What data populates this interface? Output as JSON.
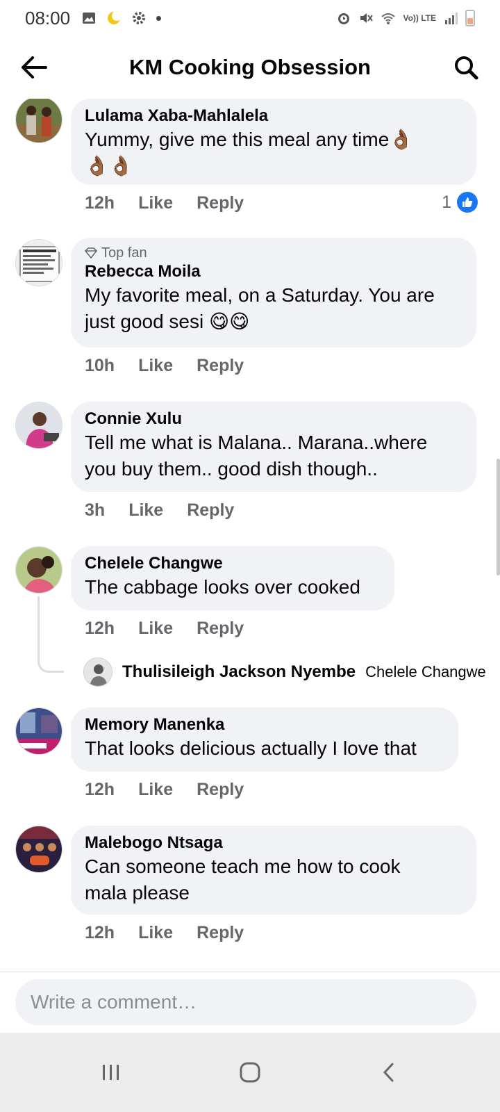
{
  "status_bar": {
    "time": "08:00",
    "network": "Vo)) LTE"
  },
  "header": {
    "title": "KM Cooking Obsession"
  },
  "comments": [
    {
      "author": "Lulama Xaba-Mahlalela",
      "text_line1": "Yummy,  give me this meal any time👌🏾",
      "text_line2": "👌🏾👌🏾",
      "time": "12h",
      "like": "Like",
      "reply": "Reply",
      "like_count": "1"
    },
    {
      "badge": "Top fan",
      "author": "Rebecca Moila",
      "text_line1": "My favorite meal, on a Saturday. You are",
      "text_line2": "just good sesi 😋😋",
      "time": "10h",
      "like": "Like",
      "reply": "Reply"
    },
    {
      "author": "Connie Xulu",
      "text_line1": "Tell me what is Malana.. Marana..where",
      "text_line2": "you buy them.. good dish though..",
      "time": "3h",
      "like": "Like",
      "reply": "Reply"
    },
    {
      "author": "Chelele Changwe",
      "text_line1": "The cabbage looks over cooked",
      "time": "12h",
      "like": "Like",
      "reply": "Reply",
      "reply_preview": {
        "author": "Thulisileigh Jackson Nyembe",
        "snippet": "Chelele Changwe"
      }
    },
    {
      "author": "Memory Manenka",
      "text_line1": "That looks delicious actually I love that",
      "time": "12h",
      "like": "Like",
      "reply": "Reply"
    },
    {
      "author": "Malebogo Ntsaga",
      "text_line1": "Can someone teach me how to cook",
      "text_line2": "mala please",
      "time": "12h",
      "like": "Like",
      "reply": "Reply"
    }
  ],
  "composer": {
    "placeholder": "Write a comment…"
  },
  "colors": {
    "bubble": "#f0f2f5",
    "meta": "#65676b",
    "accent": "#1877f2"
  },
  "icons": [
    "back-arrow-icon",
    "search-icon",
    "thumbs-up-icon",
    "diamond-icon",
    "recent-apps-icon",
    "home-icon",
    "back-nav-icon"
  ]
}
